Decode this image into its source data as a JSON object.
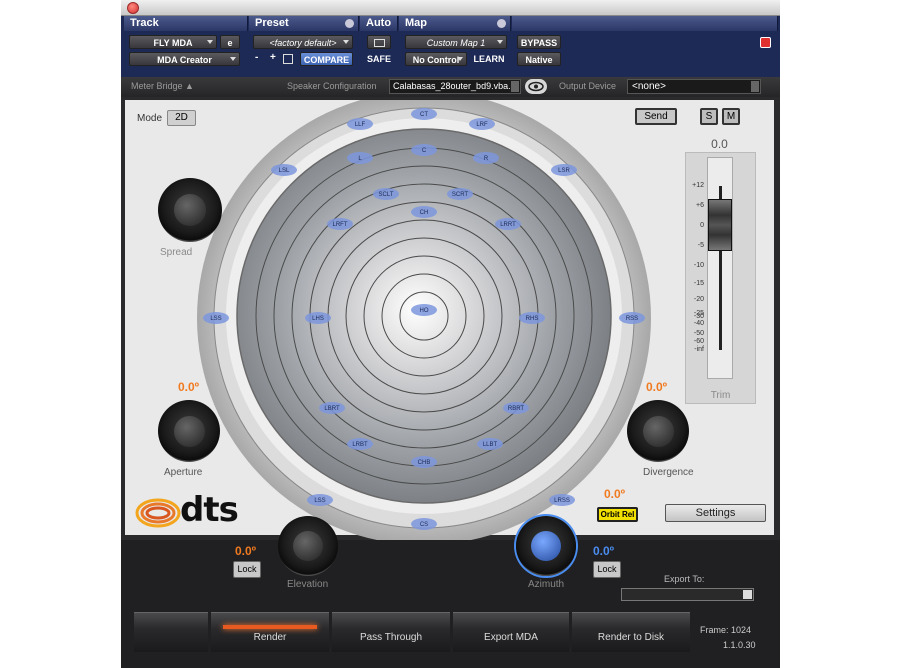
{
  "header": {
    "track_label": "Track",
    "preset_label": "Preset",
    "auto_label": "Auto",
    "map_label": "Map",
    "track_name": "FLY MDA",
    "track_e": "e",
    "plugin_name": "MDA Creator",
    "preset_name": "<factory default>",
    "preset_minus": "-",
    "preset_plus": "+",
    "compare_label": "COMPARE",
    "safe_label": "SAFE",
    "map_name": "Custom Map 1",
    "map_control": "No Control",
    "learn_label": "LEARN",
    "bypass_label": "BYPASS",
    "native_label": "Native"
  },
  "toolbar": {
    "meter_bridge": "Meter Bridge ▲",
    "speaker_config_label": "Speaker Configuration",
    "speaker_config_value": "Calabasas_28outer_bd9.vba...",
    "output_device_label": "Output Device",
    "output_device_value": "<none>"
  },
  "panel": {
    "mode_label": "Mode",
    "mode_value": "2D",
    "send_label": "Send",
    "s_label": "S",
    "m_label": "M",
    "trim_value": "0.0",
    "trim_label": "Trim",
    "trim_level": 0,
    "trim_ticks": [
      "+12",
      "+6",
      "0",
      "-5",
      "-10",
      "-15",
      "-20",
      "-25",
      "-30",
      "-40",
      "-50",
      "-60",
      "-inf"
    ],
    "spread_label": "Spread",
    "aperture_value": "0.0º",
    "aperture_label": "Aperture",
    "divergence_value": "0.0º",
    "divergence_label": "Divergence",
    "orbit_value": "0.0º",
    "orbit_label": "Orbit Rel",
    "settings_label": "Settings",
    "logo_text": "dts",
    "speakers": [
      "LLF",
      "LRF",
      "L",
      "C",
      "R",
      "LSL",
      "LSR",
      "SCLT",
      "SCRT",
      "CH",
      "LRFT",
      "LRRT",
      "LSS",
      "LHS",
      "HO",
      "RHS",
      "RSS",
      "LBRT",
      "RBRT",
      "LRBT",
      "LLBT",
      "CHB",
      "LSS",
      "LRSS",
      "CS",
      "CT"
    ]
  },
  "bottom": {
    "elevation_value": "0.0º",
    "elevation_label": "Elevation",
    "elevation_lock": "Lock",
    "azimuth_value": "0.0º",
    "azimuth_label": "Azimuth",
    "azimuth_lock": "Lock",
    "export_to_label": "Export To:",
    "render_label": "Render",
    "pass_through_label": "Pass Through",
    "export_mda_label": "Export MDA",
    "render_disk_label": "Render to Disk",
    "frame_label": "Frame: 1024",
    "version_label": "1.1.0.30"
  },
  "colors": {
    "accent_orange": "#f07a20",
    "accent_blue": "#4a8df0",
    "header_blue": "#1d2a55",
    "speaker_blue": "#7c96dd"
  }
}
